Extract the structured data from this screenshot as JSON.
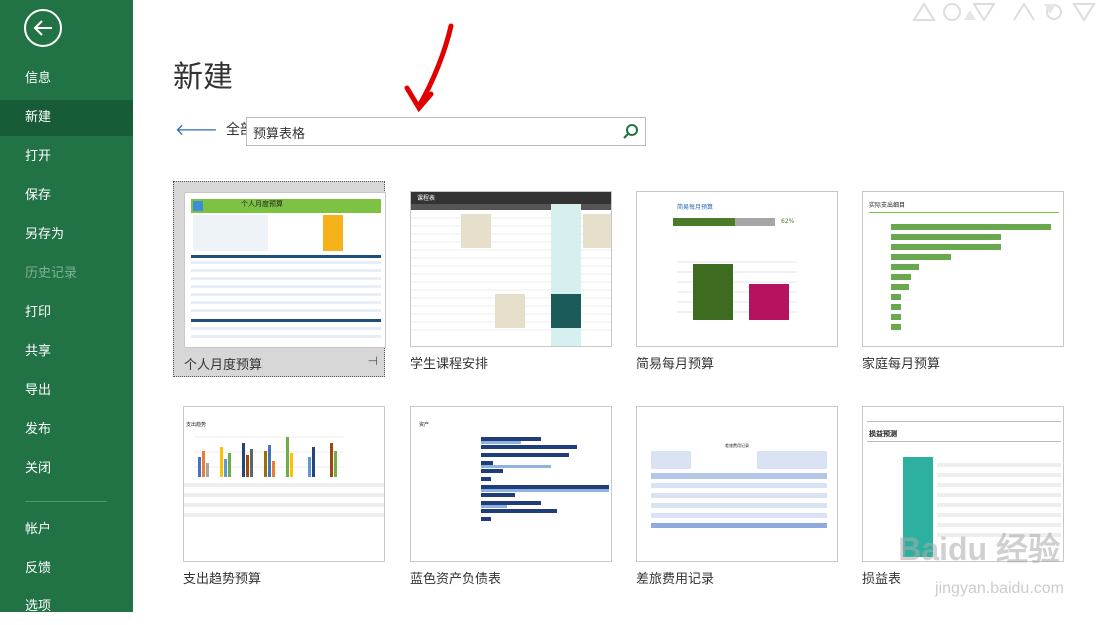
{
  "sidebar": {
    "items": [
      {
        "label": "信息"
      },
      {
        "label": "新建"
      },
      {
        "label": "打开"
      },
      {
        "label": "保存"
      },
      {
        "label": "另存为"
      },
      {
        "label": "历史记录"
      },
      {
        "label": "打印"
      },
      {
        "label": "共享"
      },
      {
        "label": "导出"
      },
      {
        "label": "发布"
      },
      {
        "label": "关闭"
      },
      {
        "label": "帐户"
      },
      {
        "label": "反馈"
      },
      {
        "label": "选项"
      }
    ]
  },
  "header": {
    "title": "新建",
    "home_label": "全部",
    "search_value": "预算表格"
  },
  "templates": [
    {
      "label": "个人月度预算",
      "thumb_title": "个人月度预算"
    },
    {
      "label": "学生课程安排",
      "thumb_title": "课程表"
    },
    {
      "label": "简易每月预算",
      "thumb_title": "简易每月预算",
      "percent": "62%"
    },
    {
      "label": "家庭每月预算",
      "thumb_title": "实际支出细目"
    },
    {
      "label": "支出趋势预算",
      "thumb_title": "支出趋势"
    },
    {
      "label": "蓝色资产负债表",
      "thumb_title": "资产"
    },
    {
      "label": "差旅费用记录",
      "thumb_title": "差旅费用记录"
    },
    {
      "label": "损益表",
      "thumb_title": "损益预测"
    }
  ],
  "colors": {
    "sidebar": "#217346",
    "active": "#185c37",
    "accent_green": "#7dc242"
  },
  "watermark": {
    "text": "Bai 经验",
    "url": "jingyan.baidu.com"
  }
}
